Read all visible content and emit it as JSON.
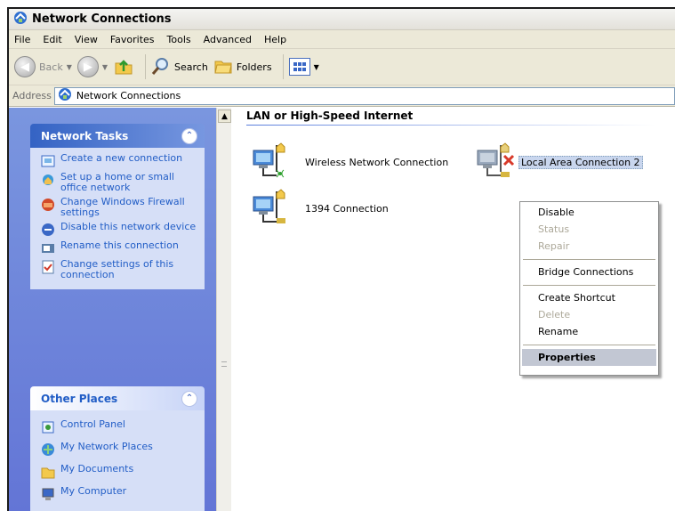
{
  "window": {
    "title": "Network Connections"
  },
  "menubar": {
    "items": [
      "File",
      "Edit",
      "View",
      "Favorites",
      "Tools",
      "Advanced",
      "Help"
    ]
  },
  "toolbar": {
    "back": "Back",
    "search": "Search",
    "folders": "Folders"
  },
  "address": {
    "label": "Address",
    "value": "Network Connections"
  },
  "network_tasks": {
    "title": "Network Tasks",
    "items": [
      {
        "label": "Create a new connection",
        "icon": "new-connection-icon"
      },
      {
        "label": "Set up a home or small office network",
        "icon": "home-network-icon"
      },
      {
        "label": "Change Windows Firewall settings",
        "icon": "firewall-icon"
      },
      {
        "label": "Disable this network device",
        "icon": "disable-device-icon"
      },
      {
        "label": "Rename this connection",
        "icon": "rename-icon"
      },
      {
        "label": "Change settings of this connection",
        "icon": "settings-icon"
      }
    ]
  },
  "other_places": {
    "title": "Other Places",
    "items": [
      {
        "label": "Control Panel",
        "icon": "control-panel-icon"
      },
      {
        "label": "My Network Places",
        "icon": "network-places-icon"
      },
      {
        "label": "My Documents",
        "icon": "documents-icon"
      },
      {
        "label": "My Computer",
        "icon": "computer-icon"
      }
    ]
  },
  "content": {
    "group_header": "LAN or High-Speed Internet",
    "connections": [
      {
        "label": "Wireless Network Connection",
        "icon": "wireless-connection-icon"
      },
      {
        "label": "Local Area Connection 2",
        "icon": "lan-disconnected-icon",
        "selected": true
      },
      {
        "label": "1394 Connection",
        "icon": "lan-connection-icon"
      }
    ]
  },
  "context_menu": {
    "items": [
      {
        "label": "Disable",
        "enabled": true
      },
      {
        "label": "Status",
        "enabled": false
      },
      {
        "label": "Repair",
        "enabled": false
      },
      {
        "label": "Bridge Connections",
        "enabled": true
      },
      {
        "label": "Create Shortcut",
        "enabled": true
      },
      {
        "label": "Delete",
        "enabled": false
      },
      {
        "label": "Rename",
        "enabled": true
      },
      {
        "label": "Properties",
        "enabled": true,
        "default": true
      }
    ]
  },
  "colors": {
    "link": "#215dc6",
    "taskpane_bg": "#6375d6",
    "panel_body": "#d6dff7",
    "disabled": "#aca899"
  }
}
